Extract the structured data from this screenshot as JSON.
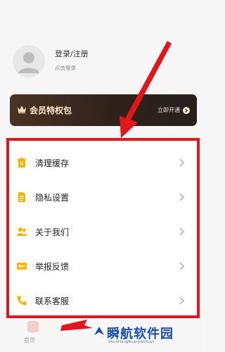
{
  "profile": {
    "login_title": "登录/注册",
    "login_sub": "点击登录"
  },
  "vip": {
    "title": "会员特权包",
    "action": "立即开通",
    "colors": {
      "bg": "#2f221b",
      "text": "#f7e6cb"
    }
  },
  "menu": {
    "highlight_color": "#e2161b",
    "icon_color": "#f5b400",
    "items": [
      {
        "label": "清理缓存",
        "icon": "trash-icon"
      },
      {
        "label": "隐私设置",
        "icon": "document-icon"
      },
      {
        "label": "关于我们",
        "icon": "people-icon"
      },
      {
        "label": "举报反馈",
        "icon": "key-icon"
      },
      {
        "label": "联系客服",
        "icon": "phone-icon"
      }
    ]
  },
  "tabbar": {
    "home_label": "首页"
  },
  "watermark": {
    "title": "瞬航软件园",
    "sub": "ShunHangRuanJianYuan"
  }
}
